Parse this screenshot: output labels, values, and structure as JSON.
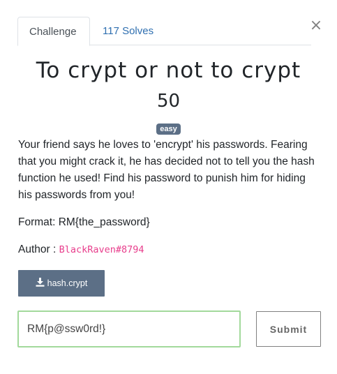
{
  "tabs": {
    "challenge_label": "Challenge",
    "solves_label": "117 Solves"
  },
  "close_glyph": "×",
  "challenge": {
    "title": "To crypt or not to crypt",
    "points": "50",
    "difficulty": "easy",
    "description": "Your friend says he loves to 'encrypt' his passwords. Fearing that you might crack it, he has decided not to tell you the hash function he used! Find his password to punish him for hiding his passwords from you!",
    "format": "Format: RM{the_password}",
    "author_label": "Author :",
    "author_handle": "BlackRaven#8794"
  },
  "file": {
    "name": "hash.crypt",
    "icon": "download-icon"
  },
  "answer": {
    "value": "RM{p@ssw0rd!}",
    "submit_label": "Submit"
  },
  "colors": {
    "accent": "#5c6f86",
    "link": "#2f6fb0",
    "handle": "#e83e8c",
    "input_border_focus": "#a2d99b"
  }
}
